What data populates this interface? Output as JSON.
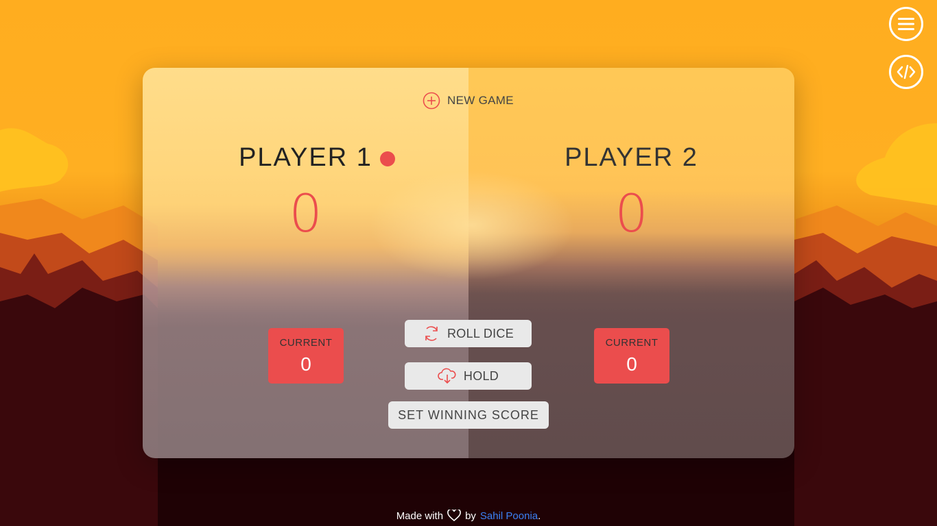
{
  "game": {
    "new_game_label": "NEW GAME",
    "players": [
      {
        "name": "PLAYER 1",
        "score": "0",
        "current_label": "CURRENT",
        "current_value": "0",
        "active": true
      },
      {
        "name": "PLAYER 2",
        "score": "0",
        "current_label": "CURRENT",
        "current_value": "0",
        "active": false
      }
    ],
    "buttons": {
      "roll": "ROLL DICE",
      "hold": "HOLD",
      "set_winning_score": "SET WINNING SCORE"
    }
  },
  "side_buttons": {
    "menu_icon": "menu-icon",
    "code_icon": "code-icon"
  },
  "footer": {
    "made_with": "Made with",
    "by": "by",
    "author": "Sahil Poonia",
    "end": "."
  },
  "colors": {
    "accent": "#eb4d4d",
    "sky": "#ffad1f",
    "ground": "#1f0205",
    "link": "#3b82f6"
  }
}
